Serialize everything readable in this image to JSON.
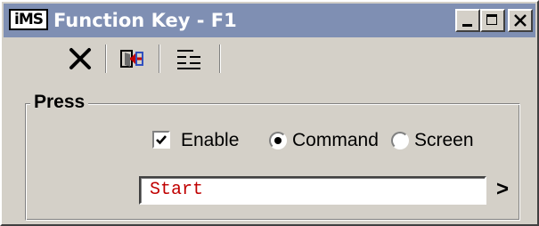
{
  "window": {
    "app_icon_text": "iMS",
    "title": "Function Key - F1",
    "controls": {
      "minimize_icon": "minimize-icon",
      "maximize_icon": "maximize-icon",
      "close_icon": "close-icon"
    }
  },
  "toolbar": {
    "tools": [
      {
        "name": "delete",
        "icon": "x-icon"
      },
      {
        "name": "exit",
        "icon": "exit-icon"
      },
      {
        "name": "list",
        "icon": "list-icon"
      }
    ]
  },
  "press_group": {
    "label": "Press",
    "enable": {
      "label": "Enable",
      "checked": true
    },
    "mode": {
      "options": [
        "Command",
        "Screen"
      ],
      "selected": "Command"
    },
    "value": "Start",
    "more_arrow": ">"
  },
  "colors": {
    "titlebar": "#7f8fb3",
    "face": "#d4d0c8",
    "field_text": "#c00000"
  }
}
